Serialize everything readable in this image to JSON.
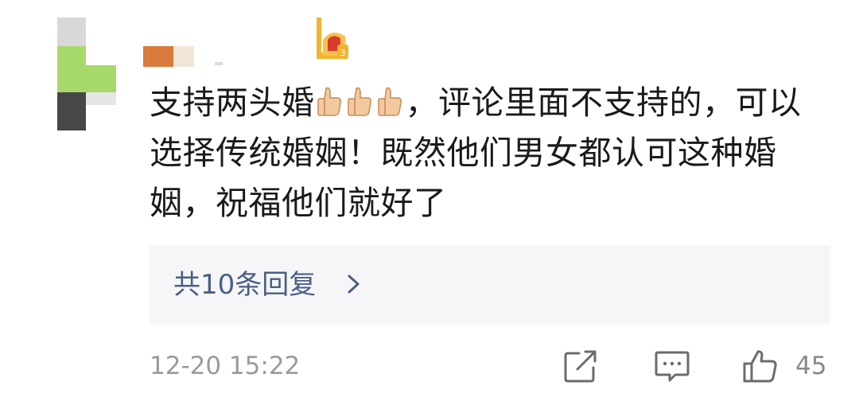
{
  "comment": {
    "text_part1": "支持两头婚",
    "emoji_repeat": [
      "thumbs-up-icon",
      "thumbs-up-icon",
      "thumbs-up-icon"
    ],
    "text_part2": "，评论里面不支持的，可以选择传统婚姻！既然他们男女都认可这种婚姻，祝福他们就好了"
  },
  "replies": {
    "label": "共10条回复",
    "chevron_icon": "chevron-right-icon"
  },
  "footer": {
    "timestamp": "12-20 15:22",
    "like_count": "45",
    "share_icon": "share-icon",
    "reply_icon": "comment-icon",
    "like_icon": "thumbs-up-outline-icon"
  },
  "colors": {
    "text": "#1a1a1a",
    "link": "#4a5f86",
    "muted": "#9a9a9a",
    "reply_bg": "#f6f6f8"
  }
}
